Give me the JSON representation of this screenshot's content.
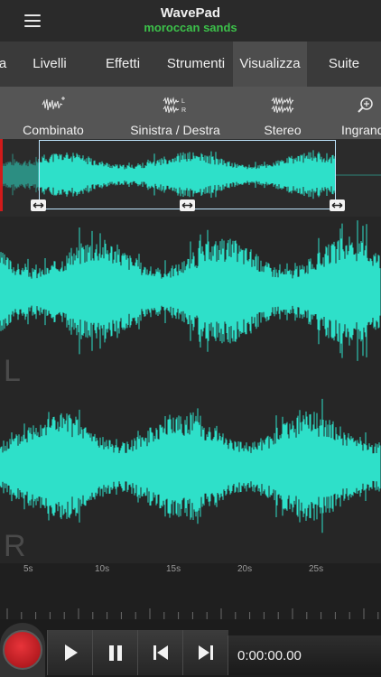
{
  "app": {
    "title": "WavePad",
    "file_name": "moroccan sands"
  },
  "tabs": [
    {
      "label": "a",
      "active": false
    },
    {
      "label": "Livelli",
      "active": false
    },
    {
      "label": "Effetti",
      "active": false
    },
    {
      "label": "Strumenti",
      "active": false
    },
    {
      "label": "Visualizza",
      "active": true
    },
    {
      "label": "Suite",
      "active": false
    }
  ],
  "toolbar": [
    {
      "label": "Combinato",
      "icon": "combined-wave-icon"
    },
    {
      "label": "Sinistra / Destra",
      "icon": "left-right-wave-icon"
    },
    {
      "label": "Stereo",
      "icon": "stereo-wave-icon"
    },
    {
      "label": "Ingrand",
      "icon": "zoom-in-icon"
    }
  ],
  "channels": {
    "left": "L",
    "right": "R"
  },
  "timeline": {
    "ticks": [
      "5s",
      "10s",
      "15s",
      "20s",
      "25s"
    ]
  },
  "transport": {
    "time": "0:00:00.00"
  },
  "colors": {
    "waveform": "#2ee0c9",
    "accent_green": "#3cc14a",
    "record_red": "#c4161c"
  }
}
